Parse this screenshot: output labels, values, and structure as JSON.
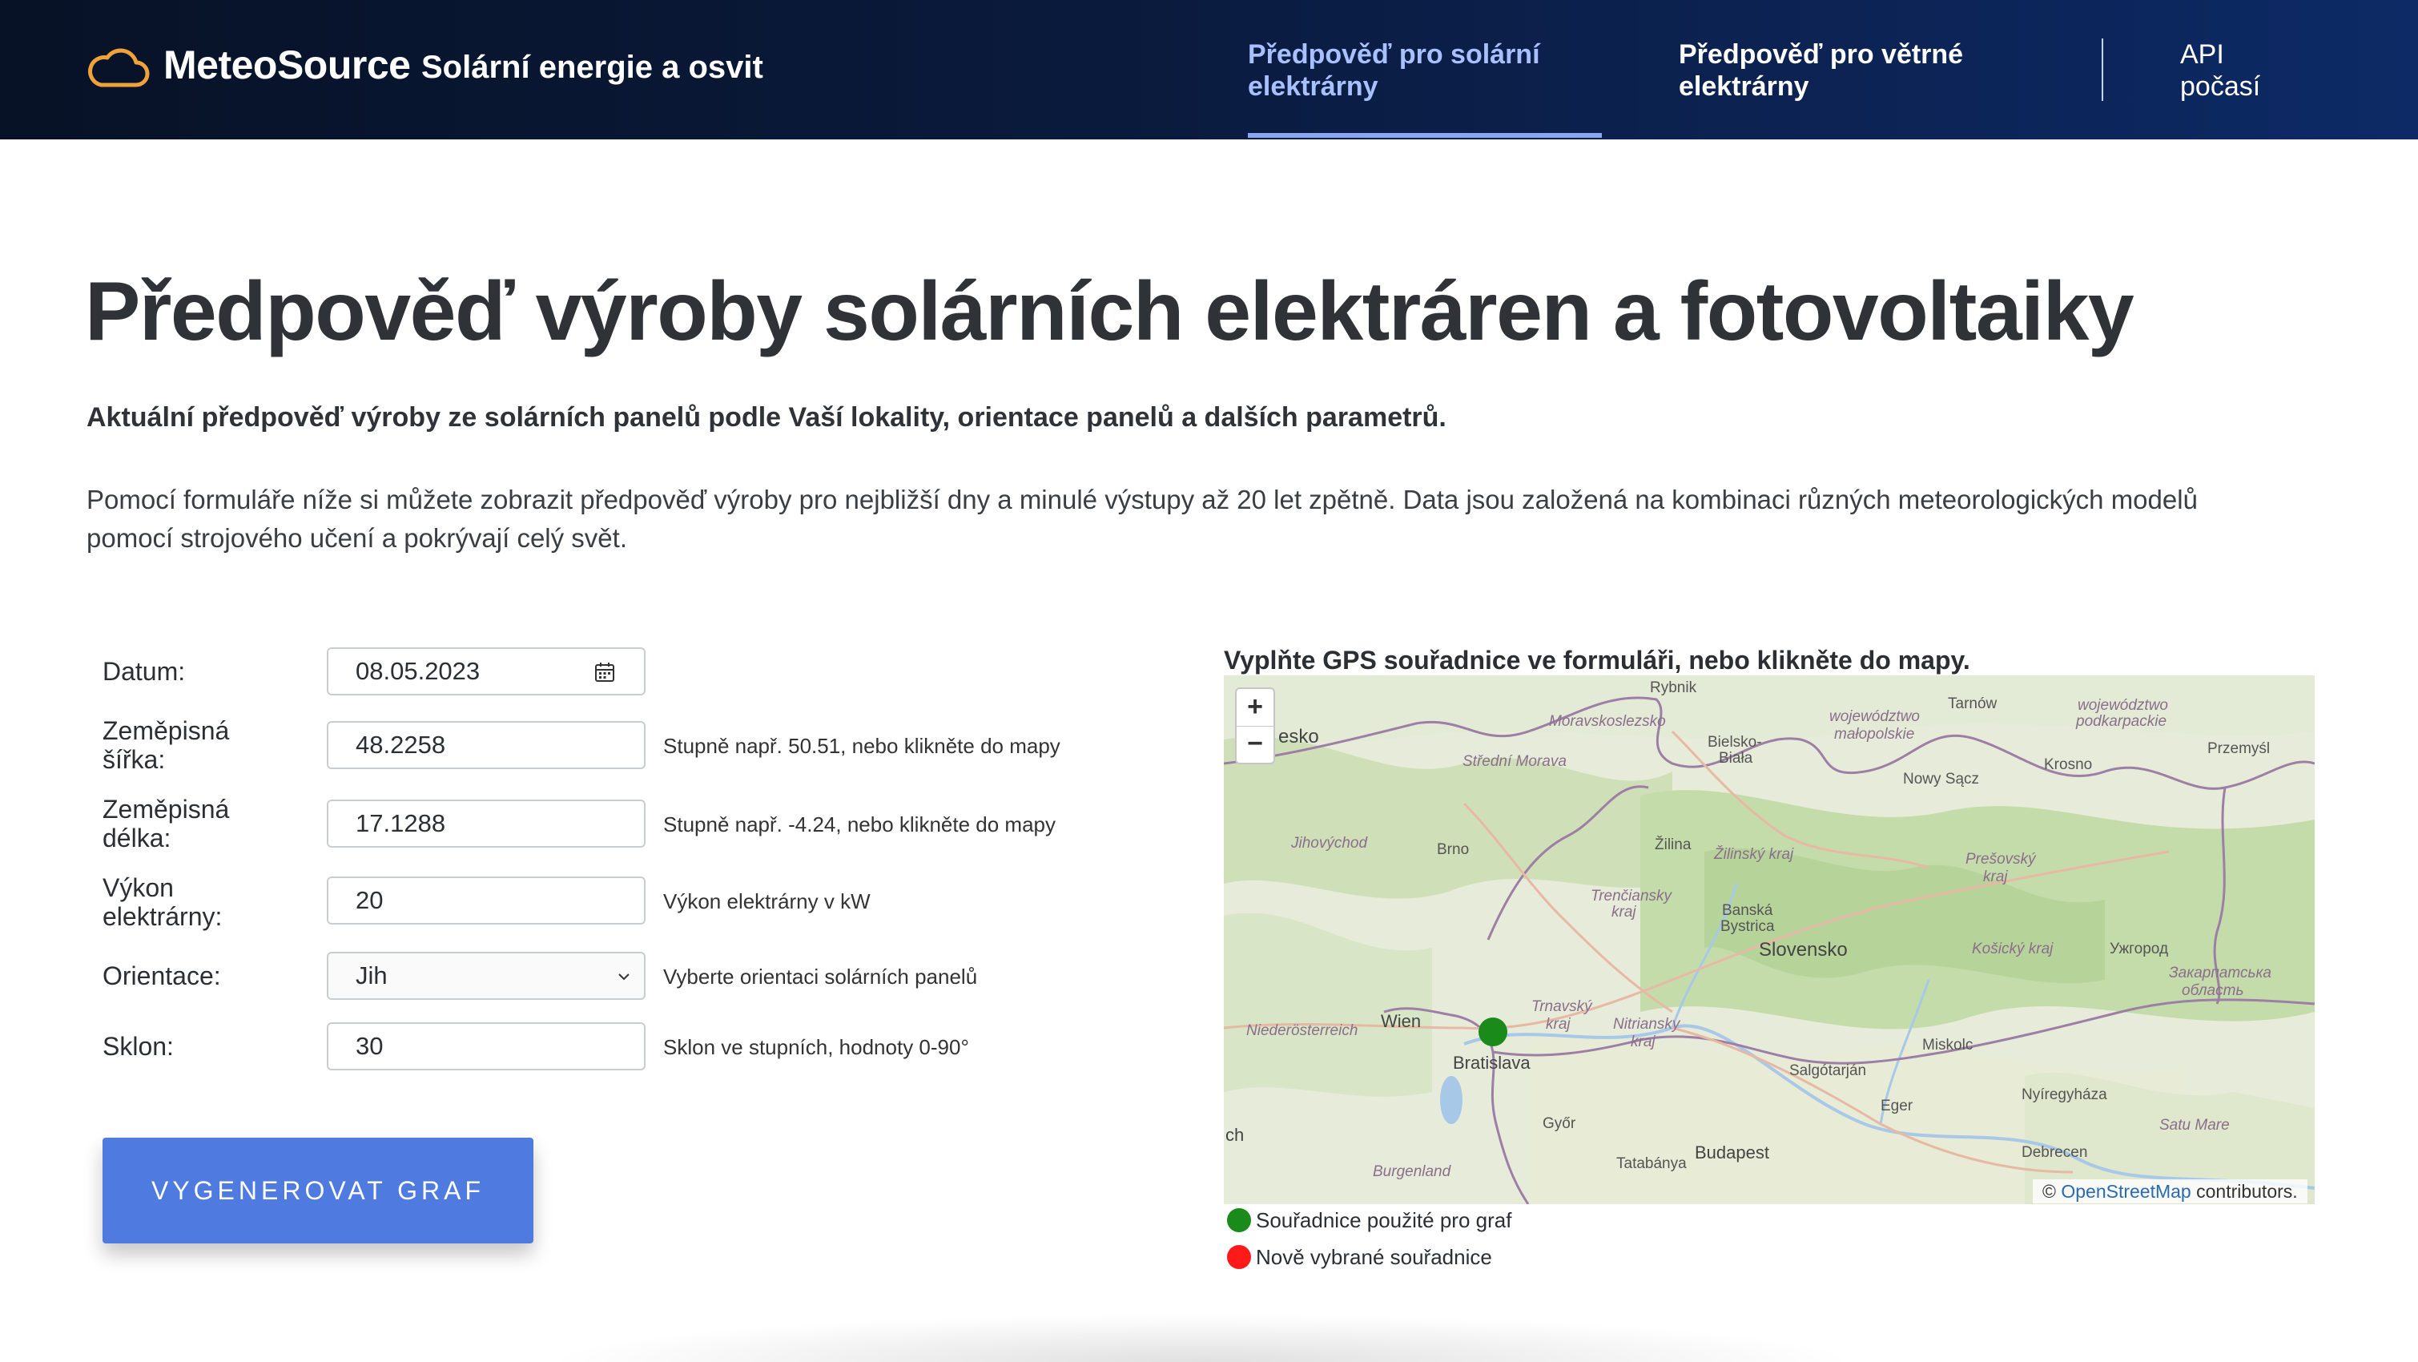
{
  "header": {
    "brand": "MeteoSource",
    "subtitle": "Solární energie a osvit",
    "nav": {
      "solar": "Předpověď pro solární elektrárny",
      "wind": "Předpověď pro větrné elektrárny",
      "api": "API počasí"
    }
  },
  "page": {
    "title": "Předpověď výroby solárních elektráren a fotovoltaiky",
    "lead": "Aktuální předpověď výroby ze solárních panelů podle Vaší lokality, orientace panelů a dalších parametrů.",
    "description": "Pomocí formuláře níže si můžete zobrazit předpověď výroby pro nejbližší dny a minulé výstupy až 20 let zpětně. Data jsou založená na kombinaci různých meteorologických modelů pomocí strojového učení a pokrývají celý svět."
  },
  "form": {
    "date": {
      "label": "Datum:",
      "value": "08.05.2023"
    },
    "lat": {
      "label": "Zeměpisná šířka:",
      "value": "48.2258",
      "hint": "Stupně např. 50.51, nebo klikněte do mapy"
    },
    "lon": {
      "label": "Zeměpisná délka:",
      "value": "17.1288",
      "hint": "Stupně např. -4.24, nebo klikněte do mapy"
    },
    "power": {
      "label": "Výkon elektrárny:",
      "value": "20",
      "hint": "Výkon elektrárny v kW"
    },
    "orientation": {
      "label": "Orientace:",
      "value": "Jih",
      "hint": "Vyberte orientaci solárních panelů"
    },
    "tilt": {
      "label": "Sklon:",
      "value": "30",
      "hint": "Sklon ve stupních, hodnoty 0-90°"
    },
    "submit": "VYGENEROVAT GRAF"
  },
  "map": {
    "instruction": "Vyplňte GPS souřadnice ve formuláři, nebo klikněte do mapy.",
    "zoom_in": "+",
    "zoom_out": "−",
    "attribution_prefix": "©",
    "attribution_link": "OpenStreetMap",
    "attribution_suffix": "contributors.",
    "labels": {
      "rybnik": "Rybnik",
      "tarnow": "Tarnów",
      "czesko": "esko",
      "moravskoslezsko": "Moravskoslezsko",
      "bielsko": "Bielsko-",
      "biala": "Biała",
      "wojewodztwo_malopolskie_1": "województwo",
      "wojewodztwo_malopolskie_2": "małopolskie",
      "wojewodztwo_podkarpackie_1": "województwo",
      "wojewodztwo_podkarpackie_2": "podkarpackie",
      "przemysl": "Przemyśl",
      "krosno": "Krosno",
      "nowy_sacz": "Nowy Sącz",
      "stredni_morava": "Střední Morava",
      "jihovychod": "Jihovýchod",
      "brno": "Brno",
      "zilina": "Žilina",
      "zilinsky": "Žilinský kraj",
      "presovsky_1": "Prešovský",
      "presovsky_2": "kraj",
      "trenciansky_1": "Trenčiansky",
      "trenciansky_2": "kraj",
      "banska_1": "Banská",
      "banska_2": "Bystrica",
      "slovensko": "Slovensko",
      "kosicky": "Košický kraj",
      "uzhorod": "Ужгород",
      "zakarpatska_1": "Закарпатська",
      "zakarpatska_2": "область",
      "trnavsky_1": "Trnavský",
      "trnavsky_2": "kraj",
      "nitriansky_1": "Nitriansky",
      "nitriansky_2": "kraj",
      "niederosterreich": "Niederösterreich",
      "wien": "Wien",
      "bratislava": "Bratislava",
      "miskolc": "Miskolc",
      "salgotarjan": "Salgótarján",
      "nyiregyhaza": "Nyíregyháza",
      "gyor": "Győr",
      "eger": "Eger",
      "budapest": "Budapest",
      "tatabanya": "Tatabánya",
      "debrecen": "Debrecen",
      "satu_mare": "Satu Mare",
      "burgenland": "Burgenland",
      "ch": "ch"
    }
  },
  "legend": {
    "used": "Souřadnice použité pro graf",
    "new": "Nově vybrané souřadnice"
  },
  "colors": {
    "accent": "#4f7be0",
    "nav_active": "#a9c0ff",
    "marker_used": "#1a8a1a",
    "marker_new": "#ff1a1a"
  }
}
